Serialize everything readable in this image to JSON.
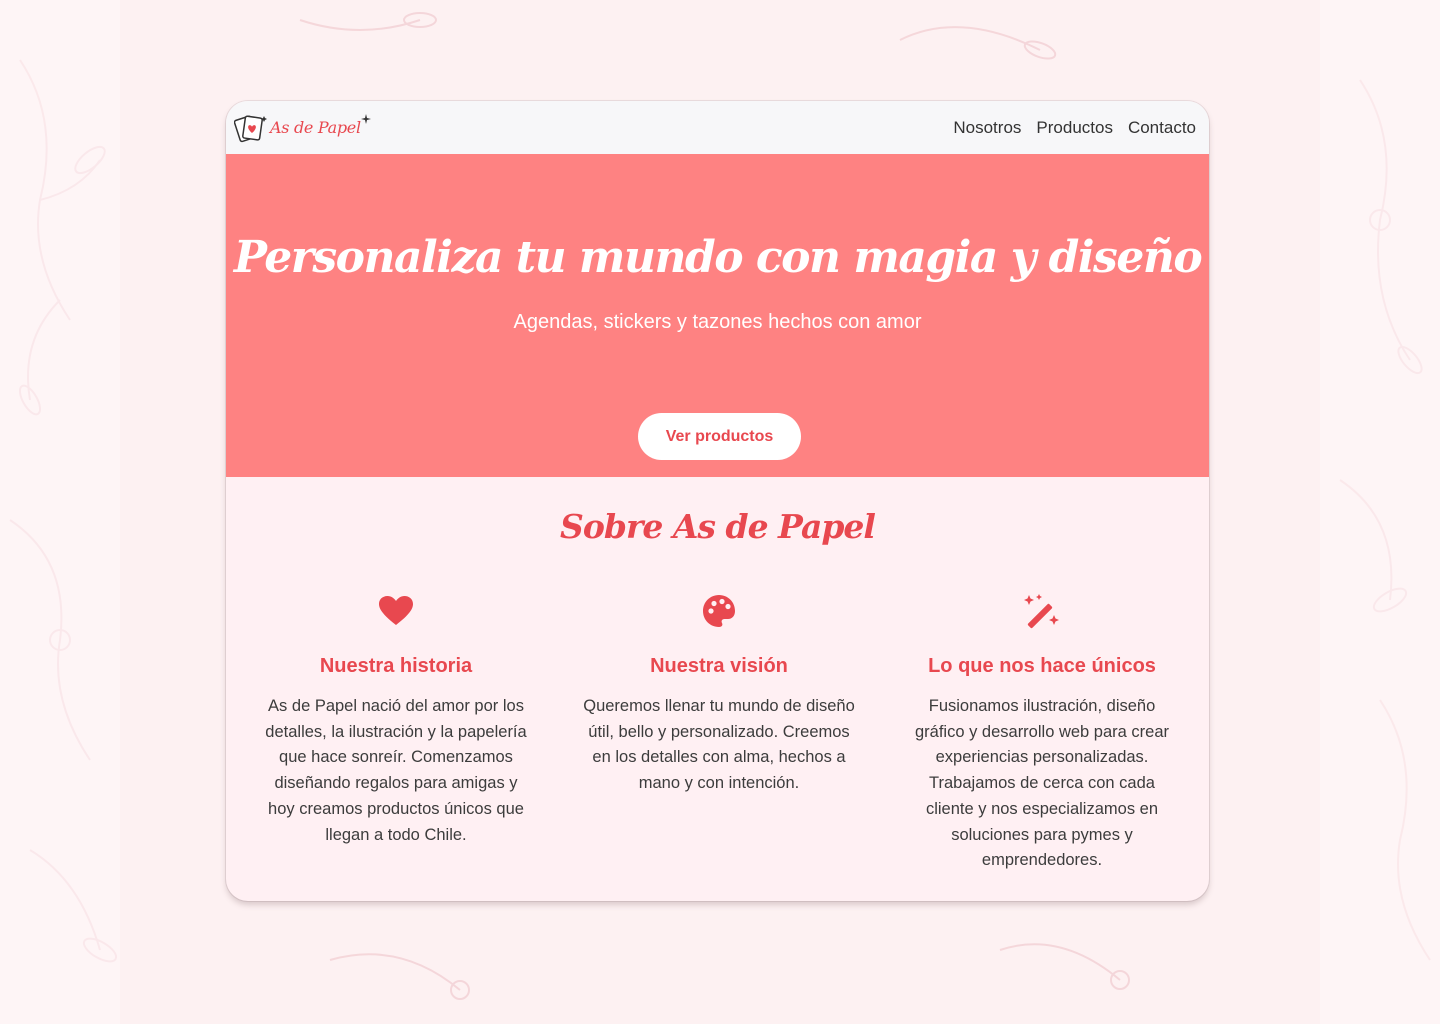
{
  "brand": {
    "name": "As de Papel",
    "accent_color": "#e8484f",
    "hero_color": "#fe8282"
  },
  "nav": {
    "links": [
      "Nosotros",
      "Productos",
      "Contacto"
    ]
  },
  "hero": {
    "title": "Personaliza tu mundo con magia y diseño",
    "subtitle": "Agendas, stickers y tazones hechos con amor",
    "button_label": "Ver productos"
  },
  "about": {
    "title": "Sobre As de Papel",
    "features": [
      {
        "icon": "heart-icon",
        "title": "Nuestra historia",
        "text": "As de Papel nació del amor por los detalles, la ilustración y la papelería que hace sonreír. Comenzamos diseñando regalos para amigas y hoy creamos productos únicos que llegan a todo Chile."
      },
      {
        "icon": "palette-icon",
        "title": "Nuestra visión",
        "text": "Queremos llenar tu mundo de diseño útil, bello y personalizado. Creemos en los detalles con alma, hechos a mano y con intención."
      },
      {
        "icon": "magic-wand-icon",
        "title": "Lo que nos hace únicos",
        "text": "Fusionamos ilustración, diseño gráfico y desarrollo web para crear experiencias personalizadas. Trabajamos de cerca con cada cliente y nos especializamos en soluciones para pymes y emprendedores."
      }
    ]
  }
}
